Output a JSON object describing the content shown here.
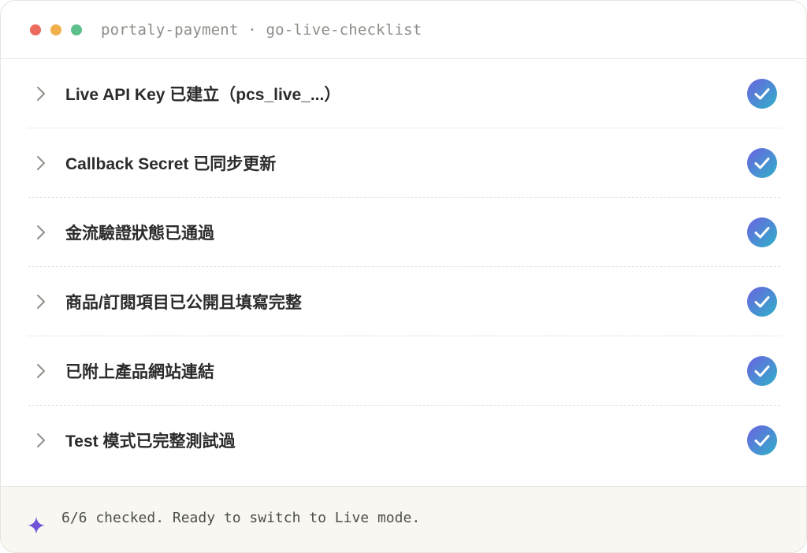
{
  "window": {
    "title": "portaly-payment · go-live-checklist",
    "controls": {
      "close_color": "#ec6a5e",
      "minimize_color": "#f1b04c",
      "maximize_color": "#5cc08a"
    }
  },
  "checklist": {
    "items": [
      {
        "label": "Live API Key 已建立（pcs_live_...）",
        "checked": true
      },
      {
        "label": "Callback Secret 已同步更新",
        "checked": true
      },
      {
        "label": "金流驗證狀態已通過",
        "checked": true
      },
      {
        "label": "商品/訂閱項目已公開且填寫完整",
        "checked": true
      },
      {
        "label": "已附上產品網站連結",
        "checked": true
      },
      {
        "label": "Test 模式已完整測試過",
        "checked": true
      }
    ],
    "check_icon_colors": [
      "#6b63e0",
      "#2fb0c8"
    ]
  },
  "footer": {
    "icon": "sparkle-icon",
    "icon_color": "#6f52d6",
    "message": "6/6 checked. Ready to switch to Live mode."
  }
}
